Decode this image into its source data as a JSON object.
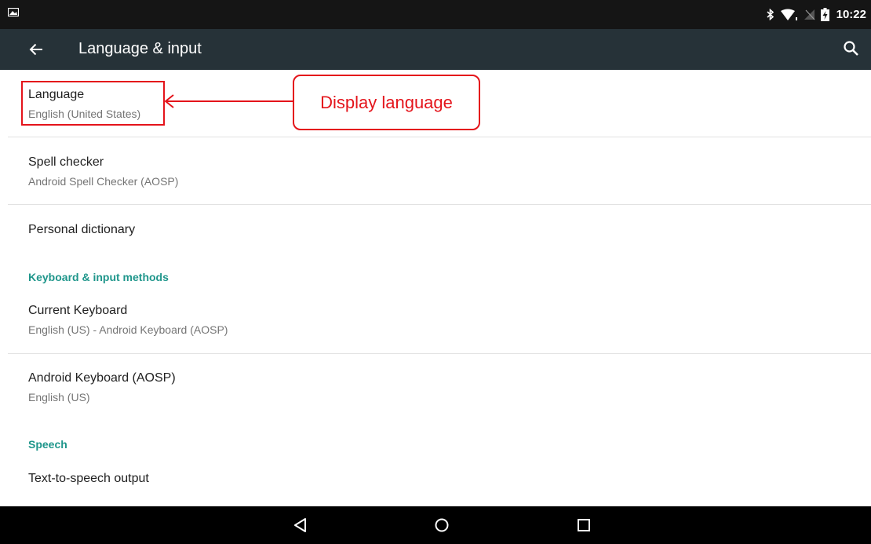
{
  "status_bar": {
    "time": "10:22",
    "icons": [
      "image-notification-icon",
      "bluetooth-icon",
      "wifi-icon",
      "no-sim-icon",
      "battery-charging-icon"
    ]
  },
  "app_bar": {
    "title": "Language & input",
    "back_icon": "arrow-left-icon",
    "search_icon": "search-icon"
  },
  "items": {
    "language": {
      "title": "Language",
      "subtitle": "English (United States)"
    },
    "spell_checker": {
      "title": "Spell checker",
      "subtitle": "Android Spell Checker (AOSP)"
    },
    "personal_dictionary": {
      "title": "Personal dictionary"
    },
    "current_keyboard": {
      "title": "Current Keyboard",
      "subtitle": "English (US) - Android Keyboard (AOSP)"
    },
    "android_keyboard": {
      "title": "Android Keyboard (AOSP)",
      "subtitle": "English (US)"
    },
    "tts_output": {
      "title": "Text-to-speech output"
    }
  },
  "sections": {
    "keyboard": "Keyboard & input methods",
    "speech": "Speech"
  },
  "annotation": {
    "callout_text": "Display language",
    "color": "#e4141b"
  },
  "nav_bar": {
    "icons": [
      "back-triangle-icon",
      "home-circle-icon",
      "recents-square-icon"
    ]
  },
  "colors": {
    "status_bar": "#151515",
    "app_bar": "#263238",
    "accent": "#1f968b",
    "primary_text": "#212121",
    "secondary_text": "#757575"
  }
}
